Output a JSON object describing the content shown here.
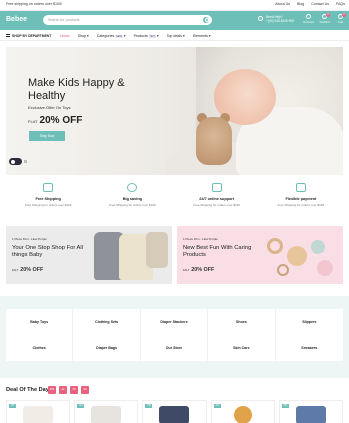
{
  "topbar": {
    "shipping_notice": "Free shipping on orders over $100!",
    "links": [
      "About Us",
      "Blog",
      "Contact Us",
      "FAQs"
    ]
  },
  "header": {
    "logo": "Bebee",
    "search_placeholder": "Search for products",
    "help_line1": "Need Help?",
    "help_line2": "+(00) 245 4545 995",
    "icons": [
      {
        "name": "user-icon",
        "label": "Account",
        "badge": ""
      },
      {
        "name": "heart-icon",
        "label": "Wishlist",
        "badge": "0"
      },
      {
        "name": "cart-icon",
        "label": "Cart",
        "badge": "0"
      }
    ],
    "accent": "#6dbfb8"
  },
  "nav": {
    "department_label": "SHOP BY DEPARTMENT",
    "items": [
      {
        "label": "Home",
        "tag": "",
        "active": true
      },
      {
        "label": "Shop",
        "tag": "",
        "active": false
      },
      {
        "label": "Categories",
        "tag": "NEW",
        "active": false
      },
      {
        "label": "Products",
        "tag": "HOT",
        "active": false
      },
      {
        "label": "Top deals",
        "tag": "",
        "active": false
      },
      {
        "label": "Elements",
        "tag": "",
        "active": false
      }
    ]
  },
  "hero": {
    "headline": "Make Kids Happy & Healthy",
    "offer": "Exclusive Offer On Toys",
    "flat_prefix": "FLAT",
    "flat_value": "20% OFF",
    "button": "Shop Now"
  },
  "features": [
    {
      "icon": "truck-icon",
      "title": "Free Shipping",
      "subtitle": "Free Shipping for orders over $199"
    },
    {
      "icon": "piggy-bank-icon",
      "title": "Big saving",
      "subtitle": "Free Shipping for orders over $199"
    },
    {
      "icon": "support-icon",
      "title": "24/7 online support",
      "subtitle": "Free Shipping for orders over $199"
    },
    {
      "icon": "card-icon",
      "title": "Flexible payment",
      "subtitle": "Free Shipping for orders over $199"
    }
  ],
  "promos": [
    {
      "tag": "1 Piece Film - Lilac Purple",
      "headline": "Your One Stop Shop For All things Baby",
      "flat_prefix": "FALT",
      "flat_value": "20% OFF"
    },
    {
      "tag": "1 Piece Film - Lilac Purple",
      "headline": "New Best Fun With Caring Products",
      "flat_prefix": "FALT",
      "flat_value": "20% OFF"
    }
  ],
  "categories": [
    "Baby Toys",
    "Clothing Sets",
    "Diaper Stackers",
    "Shoes",
    "Slippers",
    "Clothes",
    "Diaper Bags",
    "Our Store",
    "Skin Care",
    "Sneakers"
  ],
  "deal": {
    "title": "Deal Of The Day",
    "timer": [
      "365",
      "22",
      "30",
      "24"
    ]
  },
  "products": [
    {
      "discount": "-5%"
    },
    {
      "discount": "-5%"
    },
    {
      "discount": "-5%"
    },
    {
      "discount": "-5%"
    },
    {
      "discount": "-5%"
    }
  ]
}
